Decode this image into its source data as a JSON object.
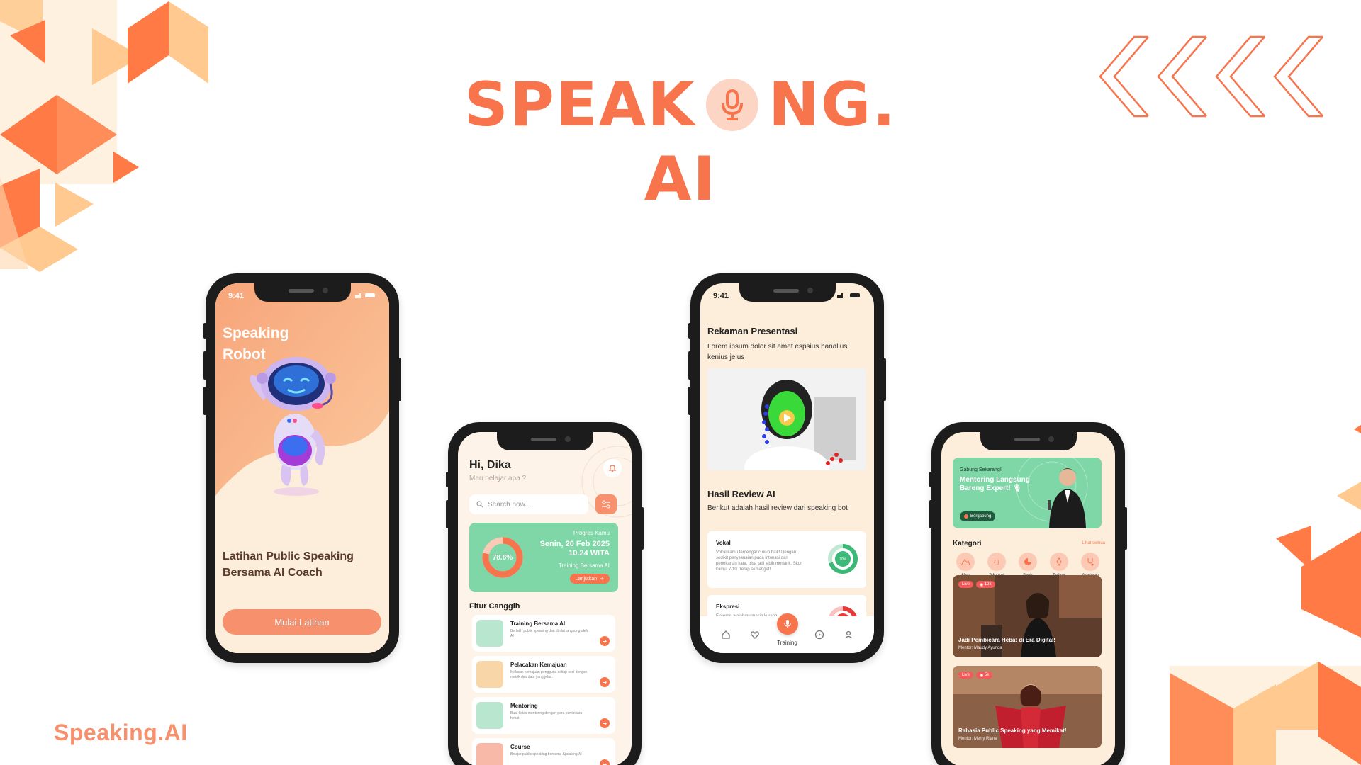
{
  "colors": {
    "accent": "#f7744d",
    "accent_soft": "#f7906d",
    "peach": "#fdeedb",
    "green": "#7fd6a7",
    "deco_orange": "#ff7a45",
    "deco_light": "#ffc98f"
  },
  "headline": {
    "line1_left": "SPEAK",
    "line1_right": "NG.",
    "line2": "AI",
    "mic_icon": "microphone-icon"
  },
  "brand_footer": "Speaking.AI",
  "phone1": {
    "status_time": "9:41",
    "title_line1": "Speaking",
    "title_line2": "Robot",
    "subtitle_line1": "Latihan Public Speaking",
    "subtitle_line2": "Bersama AI Coach",
    "button": "Mulai Latihan"
  },
  "phone2": {
    "greeting": "Hi, Dika",
    "greeting_sub": "Mau belajar apa ?",
    "search_placeholder": "Search now...",
    "progress": {
      "label": "Progres Kamu",
      "percent": "78.6%",
      "percent_value": 78.6,
      "date": "Senin, 20 Feb 2025",
      "time": "10.24 WITA",
      "session": "Training Bersama AI",
      "cta": "Lanjutkan"
    },
    "section_title": "Fitur Canggih",
    "features": [
      {
        "title": "Training Bersama AI",
        "desc": "Berlatih public speaking dan dinilai langsung oleh AI"
      },
      {
        "title": "Pelacakan Kemajuan",
        "desc": "Melacak kemajuan pengguna setiap sesi dengan metrik dan data yang jelas."
      },
      {
        "title": "Mentoring",
        "desc": "Buat kelas mentoring dengan para pembicara hebat"
      },
      {
        "title": "Course",
        "desc": "Belajar public speaking bersama Speaking.AI"
      }
    ]
  },
  "phone3": {
    "status_time": "9:41",
    "title": "Rekaman Presentasi",
    "desc": "Lorem ipsum dolor sit amet espsius hanalius kenius jeius",
    "review_title": "Hasil Review AI",
    "review_desc": "Berikut adalah hasil review dari speaking bot",
    "metrics": [
      {
        "title": "Vokal",
        "desc": "Vokal kamu terdengar cukup baik! Dengan sedikit penyesuaian pada intonasi dan penekanan kata, bisa jadi lebih menarik. Skor kamu: 7/10. Tetap semangat!",
        "score": "70%",
        "value": 70
      },
      {
        "title": "Ekspresi",
        "desc": "Ekspresi wajahmu masih kurang... Coba",
        "score": "",
        "value": 30
      }
    ],
    "nav_active": "Training"
  },
  "phone4": {
    "banner": {
      "kicker": "Gabung Sekarang!",
      "headline": "Mentoring Langsung Bareng Expert! 🎙",
      "button": "Bergabung"
    },
    "kategori_title": "Kategori",
    "see_all": "Lihat semua",
    "categories": [
      "Alam",
      "Teknologi",
      "Bisnis",
      "Budaya",
      "Kesehatan"
    ],
    "videos": [
      {
        "live": "Live",
        "views": "12k",
        "title": "Jadi Pembicara Hebat di Era Digital!",
        "mentor": "Mentor: Maudy Ayunda"
      },
      {
        "live": "Live",
        "views": "5k",
        "title": "Rahasia Public Speaking yang Memikat!",
        "mentor": "Mentor: Merry Riana"
      }
    ]
  }
}
